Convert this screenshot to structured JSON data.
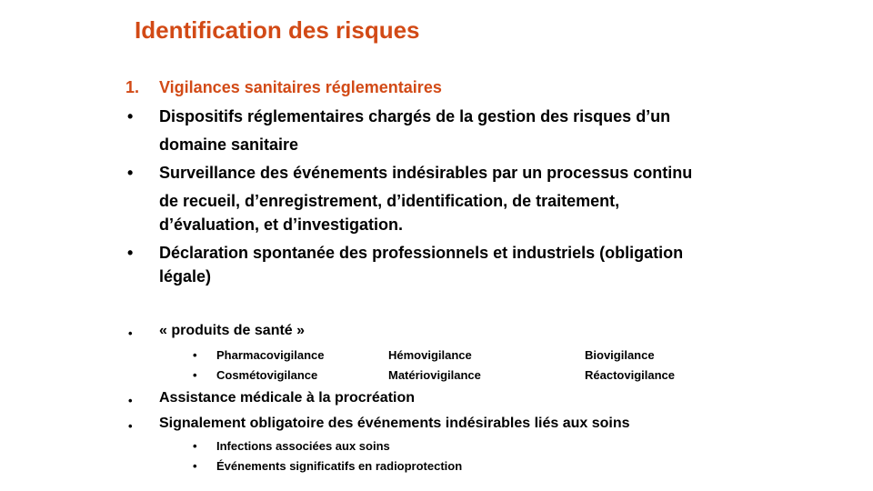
{
  "slide": {
    "title": "Identification des risques",
    "accent_color": "#d24a16",
    "section": {
      "number": "1.",
      "heading": "Vigilances  sanitaires  réglementaires"
    },
    "bullet_glyph": "•",
    "bullets": [
      {
        "lines": [
          "Dispositifs réglementaires chargés de la gestion des risques d’un",
          "domaine sanitaire"
        ]
      },
      {
        "lines": [
          "Surveillance des événements indésirables par un processus continu",
          "de recueil, d’enregistrement, d’identification, de traitement,",
          "d’évaluation, et d’investigation."
        ]
      },
      {
        "lines": [
          "Déclaration spontanée des professionnels et industriels (obligation",
          "légale)"
        ]
      }
    ],
    "health_products": {
      "label": "« produits de santé »",
      "rows": [
        [
          "Pharmacovigilance",
          "Hémovigilance",
          "Biovigilance"
        ],
        [
          "Cosmétovigilance",
          "Matériovigilance",
          "Réactovigilance"
        ]
      ]
    },
    "amp": "Assistance médicale à la procréation",
    "reporting": {
      "label": "Signalement obligatoire des événements indésirables liés aux soins",
      "items": [
        "Infections associées aux soins",
        "Événements significatifs en radioprotection"
      ]
    }
  }
}
